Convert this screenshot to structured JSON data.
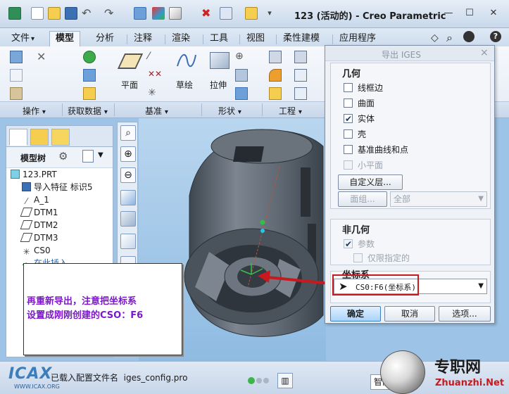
{
  "window": {
    "title": "123 (活动的) - Creo Parametric",
    "dropdown_glyph": "▾"
  },
  "tabs": [
    {
      "label": "文件",
      "arrow": "▾"
    },
    {
      "label": "模型"
    },
    {
      "label": "分析"
    },
    {
      "label": "注释"
    },
    {
      "label": "渲染"
    },
    {
      "label": "工具"
    },
    {
      "label": "视图"
    },
    {
      "label": "柔性建模"
    },
    {
      "label": "应用程序"
    }
  ],
  "ribbon": {
    "tools": {
      "plane": "平面",
      "sketch": "草绘",
      "extrude": "拉伸"
    },
    "groups": [
      {
        "label": "操作",
        "arrow": "▾"
      },
      {
        "label": "获取数据",
        "arrow": "▾"
      },
      {
        "label": "基准",
        "arrow": "▾"
      },
      {
        "label": "形状",
        "arrow": "▾"
      },
      {
        "label": "工程",
        "arrow": "▾"
      }
    ]
  },
  "model_tree": {
    "header": "模型树",
    "items": [
      {
        "label": "123.PRT"
      },
      {
        "label": "导入特征 标识5"
      },
      {
        "label": "A_1"
      },
      {
        "label": "DTM1"
      },
      {
        "label": "DTM2"
      },
      {
        "label": "DTM3"
      },
      {
        "label": "CS0"
      },
      {
        "label": "在此插入"
      }
    ]
  },
  "dialog": {
    "title": "导出 IGES",
    "close": "×",
    "geometry": {
      "title": "几何",
      "options": [
        {
          "label": "线框边",
          "checked": false
        },
        {
          "label": "曲面",
          "checked": false
        },
        {
          "label": "实体",
          "checked": true
        },
        {
          "label": "壳",
          "checked": false
        },
        {
          "label": "基准曲线和点",
          "checked": false
        },
        {
          "label": "小平面",
          "checked": false
        }
      ],
      "custom_layer_button": "自定义层...",
      "quilt_button": "面组...",
      "quilt_select": "全部"
    },
    "non_geometry": {
      "title": "非几何",
      "options": [
        {
          "label": "参数",
          "checked": true
        },
        {
          "label": "仅限指定的",
          "checked": false
        }
      ]
    },
    "coordinate_system": {
      "title": "坐标系",
      "value": "CS0:F6(坐标系)"
    },
    "ok_button": "确定",
    "cancel_button": "取消",
    "options_button": "选项..."
  },
  "annotation": {
    "line1": "再重新导出，注意把坐标系",
    "line2": "设置成刚刚创建的CSO：F6"
  },
  "status": {
    "config_label": "已载入配置文件名",
    "config_file": "iges_config.pro",
    "smart": "智能"
  },
  "watermark": {
    "left_logo": "ICAX",
    "left_url": "WWW.ICAX.ORG",
    "right_name": "专职网",
    "right_url": "Zhuanzhi.Net"
  },
  "colors": {
    "accent": "#2f6fb4",
    "annotation_text": "#7b18c8",
    "annotation_arrow": "#c8191e",
    "model_body": "#5d6670"
  }
}
